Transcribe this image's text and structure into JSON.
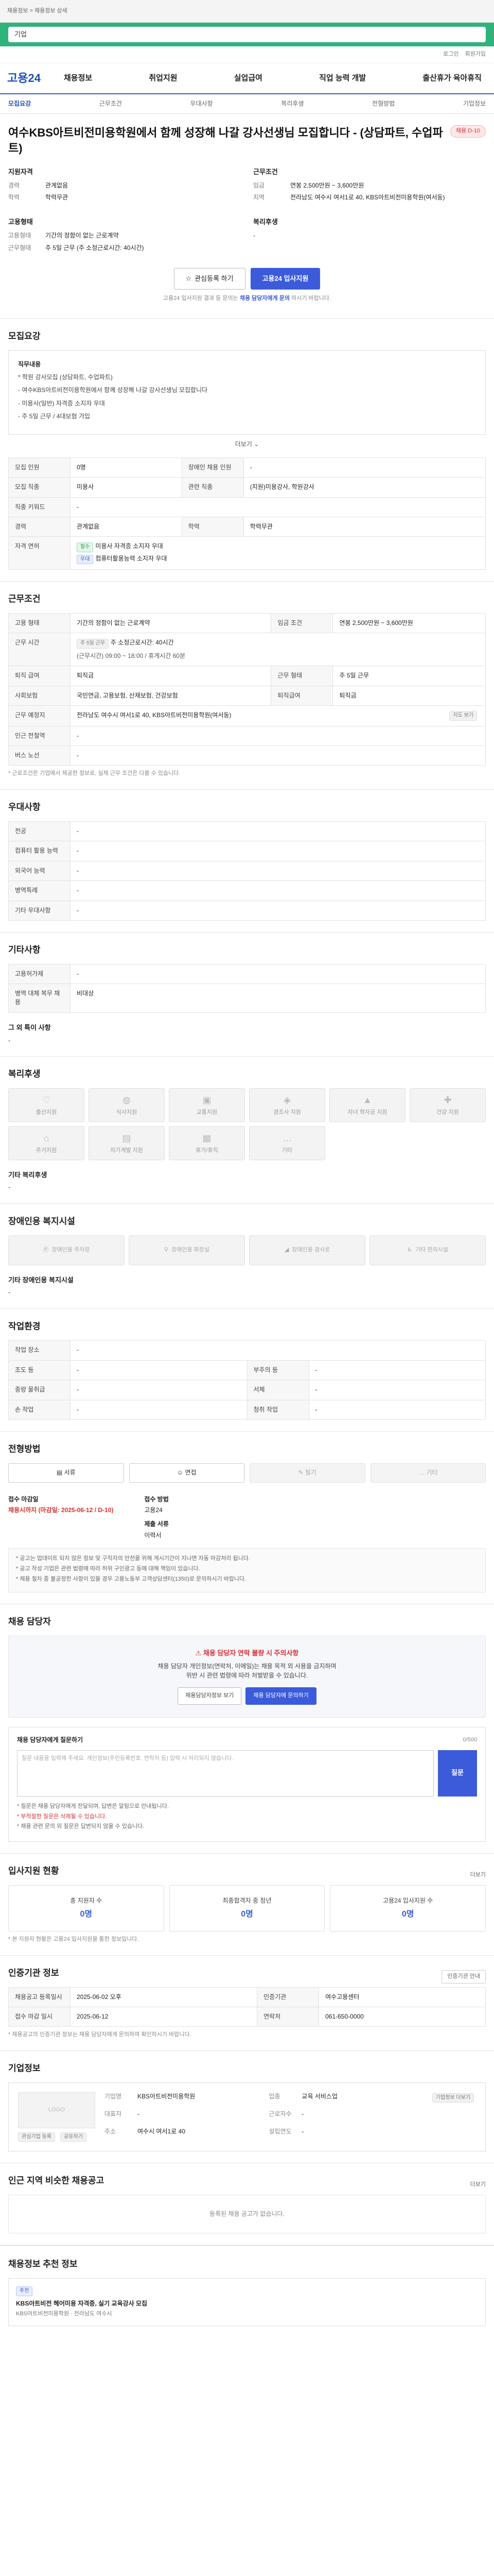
{
  "browser": {
    "breadcrumb": "채용정보 > 채용정보 상세"
  },
  "search": {
    "value": "기업"
  },
  "utility": [
    "로그인",
    "회원가입"
  ],
  "gnb": {
    "logo": "고용24",
    "menu": [
      "채용정보",
      "취업지원",
      "실업급여",
      "직업 능력 개발",
      "출산휴가 육아휴직"
    ]
  },
  "tabs": [
    "모집요강",
    "근무조건",
    "우대사항",
    "복리후생",
    "전형방법",
    "기업정보"
  ],
  "job": {
    "title": "여수KBS아트비전미용학원에서 함께 성장해 나갈 강사선생님 모집합니다 - (상담파트, 수업파트)",
    "badge": "채용 D-10",
    "left_head": "지원자격",
    "left": [
      {
        "k": "경력",
        "v": "관계없음"
      },
      {
        "k": "학력",
        "v": "학력무관"
      }
    ],
    "right_head": "근무조건",
    "right": [
      {
        "k": "임금",
        "v": "연봉 2,500만원 ~ 3,600만원"
      },
      {
        "k": "지역",
        "v": "전라남도 여수시 여서1로 40, KBS아트비전미용학원(여서동)"
      }
    ],
    "left2_head": "고용형태",
    "left2": [
      {
        "k": "고용형태",
        "v": "기간의 정함이 없는 근로계약"
      },
      {
        "k": "근무형태",
        "v": "주 5일 근무 (주 소정근로시간: 40시간)"
      }
    ],
    "right2_head": "복리후생",
    "right2": [
      {
        "k": "",
        "v": "-"
      }
    ],
    "btn_interest": "관심등록 하기",
    "btn_apply": "고용24 입사지원",
    "apply_note_prefix": "고용24 입사지원 결과 등 문의는",
    "apply_note_link": "채용 담당자에게 문의",
    "apply_note_suffix": "하시기 바랍니다."
  },
  "recruit": {
    "heading": "모집요강",
    "box_title": "직무내용",
    "lines": [
      "* 학원 강사모집 (상담파트, 수업파트)",
      "- 여수KBS아트비전미용학원에서 함께 성장해 나갈 강사선생님 모집합니다",
      "- 미용사(일반) 자격증 소지자 우대",
      "- 주 5일 근무 / 4대보험 가입"
    ],
    "more": "더보기",
    "rows": [
      [
        {
          "k": "모집 인원",
          "v": "0명"
        },
        {
          "k": "장애인 채용 인원",
          "v": "-"
        }
      ],
      [
        {
          "k": "모집 직종",
          "v": "미용사"
        },
        {
          "k": "관련 직종",
          "v": "(지원)미용강사, 학원강사"
        }
      ],
      [
        {
          "k": "직종 키워드",
          "v": "-"
        },
        {
          "k": "",
          "v": ""
        }
      ],
      [
        {
          "k": "경력",
          "v": "관계없음"
        },
        {
          "k": "학력",
          "v": "학력무관"
        }
      ]
    ],
    "license_label": "자격 면허",
    "license_lines": [
      "미용사 자격증 소지자 우대",
      "컴퓨터활용능력 소지자 우대"
    ],
    "license_tags": [
      "필수",
      "우대"
    ]
  },
  "conditions": {
    "heading": "근무조건",
    "rows": [
      {
        "k": "고용 형태",
        "v": "기간의 정함이 없는 근로계약",
        "k2": "임금 조건",
        "v2": "연봉 2,500만원 ~ 3,600만원"
      },
      {
        "k": "근무 시간",
        "v": "주 소정근로시간: 40시간",
        "k2": "",
        "v2": ""
      },
      {
        "k": "퇴직 급여",
        "v": "퇴직금",
        "k2": "근무 형태",
        "v2": "주 5일 근무"
      },
      {
        "k": "사회보험",
        "v": "국민연금, 고용보험, 산재보험, 건강보험",
        "k2": "퇴직급여",
        "v2": "퇴직금"
      },
      {
        "k": "근무 예정지",
        "v": "전라남도 여수시 여서1로 40, KBS아트비전미용학원(여서동)",
        "k2": "",
        "v2": ""
      },
      {
        "k": "인근 전철역",
        "v": "-",
        "k2": "",
        "v2": ""
      },
      {
        "k": "버스 노선",
        "v": "-",
        "k2": "",
        "v2": ""
      }
    ],
    "hours_tag": "주 5일 근무",
    "hours_detail": "(근무시간) 09:00 ~ 18:00 / 휴게시간 60분",
    "map_button": "지도 보기",
    "note": "* 근로조건은 기업에서 제공한 정보로, 실제 근무 조건은 다를 수 있습니다."
  },
  "preference": {
    "heading": "우대사항",
    "rows": [
      {
        "k": "전공",
        "v": "-"
      },
      {
        "k": "컴퓨터 활용 능력",
        "v": "-"
      },
      {
        "k": "외국어 능력",
        "v": "-"
      },
      {
        "k": "병역특례",
        "v": "-"
      },
      {
        "k": "기타 우대사항",
        "v": "-"
      }
    ]
  },
  "other": {
    "heading": "기타사항",
    "rows": [
      {
        "k": "고용허가제",
        "v": "-"
      },
      {
        "k": "병역 대체 복무 채용",
        "v": "비대상"
      }
    ],
    "extra_label": "그 외 특이 사항",
    "extra_value": "-"
  },
  "welfare": {
    "heading": "복리후생",
    "items": [
      "출산지원",
      "식사지원",
      "교통지원",
      "경조사 지원",
      "자녀 학자금 지원",
      "건강 지원",
      "주거지원",
      "자기계발 지원",
      "휴가/휴직",
      "기타"
    ],
    "other_label": "기타 복리후생",
    "other_value": "-"
  },
  "disability": {
    "heading": "장애인용 복지시설",
    "items": [
      "장애인용 주차장",
      "장애인용 화장실",
      "장애인용 경사로",
      "기타 편의시설"
    ],
    "other_label": "기타 장애인용 복지시설",
    "other_value": "-"
  },
  "environment": {
    "heading": "작업환경",
    "rows": [
      {
        "k": "작업 장소",
        "v": "-",
        "k2": "",
        "v2": ""
      },
      {
        "k": "조도 등",
        "v": "-",
        "k2": "부주의 등",
        "v2": "-"
      },
      {
        "k": "중량 물취급",
        "v": "-",
        "k2": "서체",
        "v2": "-"
      },
      {
        "k": "손 작업",
        "v": "-",
        "k2": "청취 작업",
        "v2": "-"
      }
    ]
  },
  "process": {
    "heading": "전형방법",
    "steps": [
      "서류",
      "면접",
      "필기",
      "기타"
    ],
    "deadline_label": "접수 마감일",
    "deadline_value": "채용시까지 (마감일: 2025-06-12 / D-10)",
    "method_label": "접수 방법",
    "method_value": "고용24",
    "docs_label": "제출 서류",
    "docs_value": "이력서",
    "notes": [
      "* 공고는 업데이트 되지 않은 정보 및 구직자의 안전을 위해 게시기간이 지나면 자동 마감처리 됩니다.",
      "* 공고 작성 기업은 관련 법령에 따라 허위 구인광고 등에 대해 책임이 있습니다.",
      "* 채용 절차 중 불공정한 사항이 있을 경우 고용노동부 고객상담센터(1350)로 문의하시기 바랍니다."
    ]
  },
  "contact": {
    "heading": "채용 담당자",
    "warn": "채용 담당자 연락 불량 시 주의사항",
    "line1": "채용 담당자 개인정보(연락처, 이메일)는 채용 목적 외 사용을 금지하며",
    "line2": "위반 시 관련 법령에 따라 처벌받을 수 있습니다.",
    "btn_view": "채용담당자정보 보기",
    "btn_apply": "채용 담당자에 문의하기"
  },
  "qa": {
    "title": "채용 담당자에게 질문하기",
    "counter": "0/500",
    "placeholder": "질문 내용을 입력해 주세요. 개인정보(주민등록번호, 연락처 등) 입력 시 처리되지 않습니다.",
    "send": "질문",
    "rules": [
      "* 질문은 채용 담당자에게 전달되며, 답변은 알림으로 안내됩니다.",
      "* 부적절한 질문은 삭제될 수 있습니다.",
      "* 채용 관련 문의 외 질문은 답변되지 않을 수 있습니다."
    ]
  },
  "apply_stats": {
    "heading": "입사지원 현황",
    "more": "더보기",
    "items": [
      {
        "label": "총 지원자 수",
        "value": "0명"
      },
      {
        "label": "최종합격자 중 청년",
        "value": "0명"
      },
      {
        "label": "고용24 입사지원 수",
        "value": "0명"
      }
    ],
    "note": "* 본 지원자 현황은 고용24 입사지원을 통한 정보입니다."
  },
  "agency": {
    "heading": "인증기관 정보",
    "btn": "인증기관 안내",
    "rows": [
      {
        "k": "채용공고 등록일시",
        "v": "2025-06-02 오후",
        "k2": "인증기관",
        "v2": "여수고용센터"
      },
      {
        "k": "접수 마감 일시",
        "v": "2025-06-12",
        "k2": "연락처",
        "v2": "061-650-0000"
      }
    ],
    "note": "* 채용공고의 인증기관 정보는 채용 담당자에게 문의하여 확인하시기 바랍니다."
  },
  "company": {
    "heading": "기업정보",
    "btn": "기업정보 더보기",
    "logo_text": "LOGO",
    "rows": [
      {
        "k": "기업명",
        "v": "KBS아트비전미용학원"
      },
      {
        "k": "업종",
        "v": "교육 서비스업"
      },
      {
        "k": "대표자",
        "v": "-"
      },
      {
        "k": "근로자수",
        "v": "-"
      },
      {
        "k": "주소",
        "v": "여수시 여서1로 40"
      },
      {
        "k": "설립연도",
        "v": "-"
      }
    ],
    "follow": "관심기업 등록",
    "share": "공유하기"
  },
  "similar": {
    "heading": "인근 지역 비슷한 채용공고",
    "more": "더보기",
    "empty": "등록된 채용 공고가 없습니다."
  },
  "footer": {
    "heading": "채용정보 추천 정보",
    "card_tag": "추천",
    "card_title": "KBS아트비전 헤어미용 자격증, 실기 교육강사 모집",
    "card_sub": "KBS아트비전미용학원 · 전라남도 여수시"
  }
}
